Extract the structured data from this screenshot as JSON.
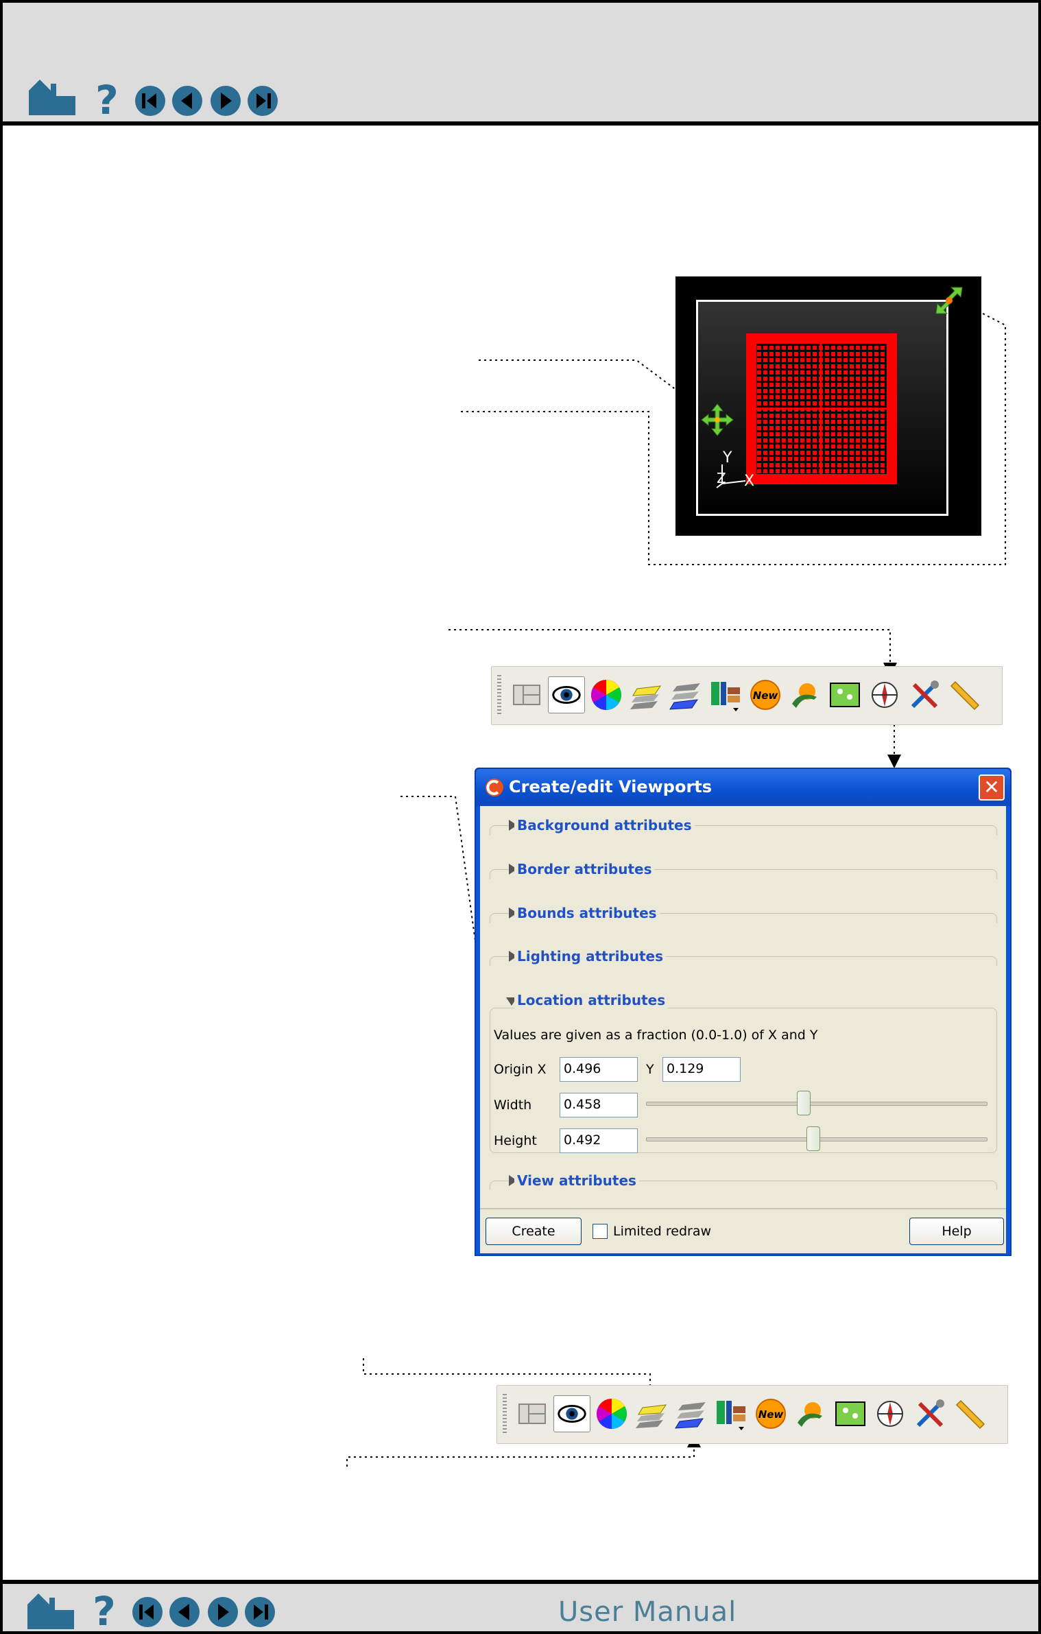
{
  "header": {
    "nav_icons": [
      "home-icon",
      "help-icon",
      "first-page-icon",
      "previous-page-icon",
      "next-page-icon",
      "last-page-icon"
    ]
  },
  "footer": {
    "title": "User Manual",
    "nav_icons": [
      "home-icon",
      "help-icon",
      "first-page-icon",
      "previous-page-icon",
      "next-page-icon",
      "last-page-icon"
    ]
  },
  "viewport_graphic": {
    "axis_y": "Y",
    "axis_z": "Z",
    "axis_x": "X"
  },
  "toolbar": {
    "buttons": [
      "viewport-layout-icon",
      "eye-icon",
      "color-wheel-icon",
      "layers-yellow-icon",
      "layers-blue-icon",
      "column-layout-icon",
      "new-icon",
      "bird-icon",
      "map-icon",
      "compass-icon",
      "tools-icon",
      "ruler-icon"
    ],
    "selected": "eye-icon"
  },
  "dialog": {
    "title": "Create/edit Viewports",
    "sections": {
      "background": "Background attributes",
      "border": "Border attributes",
      "bounds": "Bounds attributes",
      "lighting": "Lighting attributes",
      "location": "Location attributes",
      "view": "View attributes"
    },
    "location": {
      "hint": "Values are given as a fraction (0.0-1.0) of X and Y",
      "origin_x_label": "Origin X",
      "origin_x": "0.496",
      "y_label": "Y",
      "origin_y": "0.129",
      "width_label": "Width",
      "width": "0.458",
      "height_label": "Height",
      "height": "0.492"
    },
    "create_label": "Create",
    "limited_redraw_label": "Limited redraw",
    "limited_redraw_checked": false,
    "help_label": "Help"
  }
}
